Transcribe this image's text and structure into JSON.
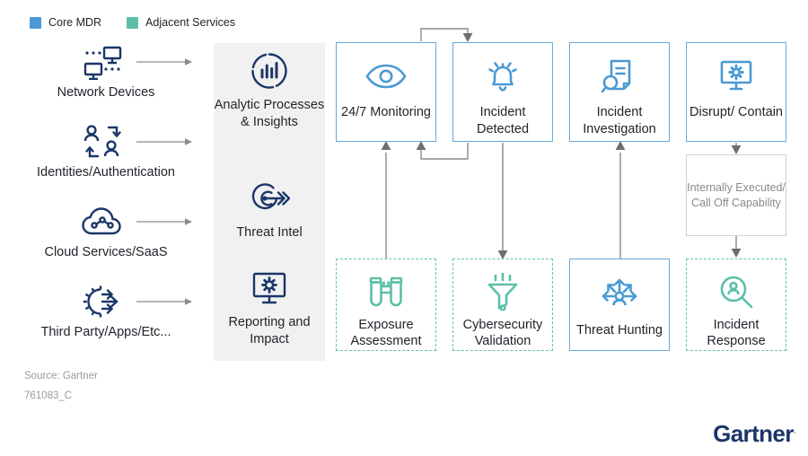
{
  "legend": {
    "items": [
      {
        "label": "Core MDR",
        "color": "#4a9ad4",
        "icon": "square-swatch-icon"
      },
      {
        "label": "Adjacent Services",
        "color": "#5cbfa8",
        "icon": "square-swatch-icon"
      }
    ]
  },
  "sources": {
    "items": [
      {
        "label": "Network Devices",
        "icon": "network-devices-icon"
      },
      {
        "label": "Identities/Authentication",
        "icon": "identities-authentication-icon"
      },
      {
        "label": "Cloud Services/SaaS",
        "icon": "cloud-services-icon"
      },
      {
        "label": "Third Party/Apps/Etc...",
        "icon": "third-party-apps-icon"
      }
    ]
  },
  "capabilities": {
    "items": [
      {
        "label": "Analytic Processes & Insights",
        "icon": "analytics-chart-icon"
      },
      {
        "label": "Threat Intel",
        "icon": "target-arrow-icon"
      },
      {
        "label": "Reporting and Impact",
        "icon": "monitor-gear-icon"
      }
    ]
  },
  "process": {
    "top_row": [
      {
        "label": "24/7 Monitoring",
        "icon": "eye-icon",
        "category": "Core MDR"
      },
      {
        "label": "Incident Detected",
        "icon": "alert-bell-icon",
        "category": "Core MDR"
      },
      {
        "label": "Incident Investigation",
        "icon": "document-magnifier-icon",
        "category": "Core MDR"
      },
      {
        "label": "Disrupt/ Contain",
        "icon": "monitor-gear-icon",
        "category": "Core MDR"
      }
    ],
    "bottom_row": [
      {
        "label": "Exposure Assessment",
        "icon": "binoculars-icon",
        "category": "Adjacent Services"
      },
      {
        "label": "Cybersecurity Validation",
        "icon": "funnel-icon",
        "category": "Adjacent Services"
      },
      {
        "label": "Threat Hunting",
        "icon": "threat-hunting-icon",
        "category": "Core MDR"
      },
      {
        "label": "Incident Response",
        "icon": "person-magnifier-icon",
        "category": "Adjacent Services"
      }
    ],
    "note": {
      "label": "Internally Executed/ Call Off Capability"
    }
  },
  "footer": {
    "source": "Source: Gartner",
    "id": "761083_C",
    "brand": "Gartner",
    "registered_mark": "."
  },
  "colors": {
    "core_blue": "#4a9ad4",
    "adjacent_teal": "#5cbfa8",
    "icon_navy": "#1b3668",
    "connector_gray": "#808080",
    "panel_gray": "#f1f1f1"
  }
}
